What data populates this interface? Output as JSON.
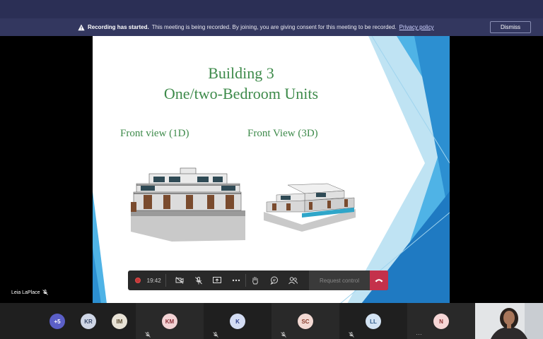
{
  "banner": {
    "title": "Recording has started.",
    "message": "This meeting is being recorded. By joining, you are giving consent for this meeting to be recorded.",
    "link": "Privacy policy",
    "dismiss": "Dismiss"
  },
  "slide": {
    "title_line1": "Building 3",
    "title_line2": "One/two-Bedroom Units",
    "label_left": "Front view (1D)",
    "label_right": "Front View (3D)"
  },
  "presenter": {
    "name": "Leia LaPlace"
  },
  "controls": {
    "timer": "19:42",
    "request_control": "Request control"
  },
  "participants": [
    {
      "initials": "+5",
      "bg": "#5b5fc7",
      "fg": "#ffffff"
    },
    {
      "initials": "KR",
      "bg": "#cfd6e6",
      "fg": "#3a4a6b"
    },
    {
      "initials": "IM",
      "bg": "#e8e2d6",
      "fg": "#5a4a2f"
    },
    {
      "initials": "KM",
      "bg": "#f3d3d5",
      "fg": "#8a2f38"
    },
    {
      "initials": "K",
      "bg": "#d3dcf3",
      "fg": "#2f3f8a"
    },
    {
      "initials": "SC",
      "bg": "#f3d9d3",
      "fg": "#8a3f2f"
    },
    {
      "initials": "LL",
      "bg": "#d3e3f3",
      "fg": "#2f5a8a"
    },
    {
      "initials": "N",
      "bg": "#f6d6d6",
      "fg": "#8a2f2f"
    }
  ],
  "colors": {
    "accent": "#5b5fc7",
    "slide_text": "#3d8a4a",
    "hangup": "#c4314b"
  }
}
